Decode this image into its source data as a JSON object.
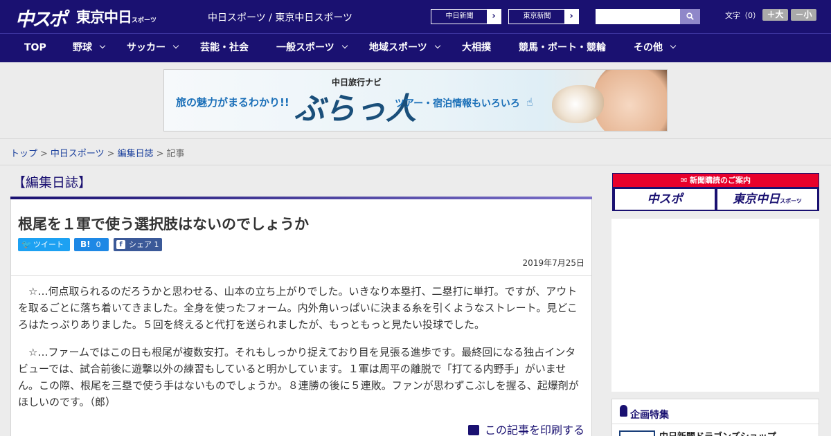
{
  "header": {
    "logo_main": "中スポ",
    "logo_sub": "東京中日",
    "logo_sub_small": "スポーツ",
    "site_links": "中日スポーツ / 東京中日スポーツ",
    "buttons": [
      {
        "label": "中日新聞"
      },
      {
        "label": "東京新聞"
      }
    ],
    "search_placeholder": "",
    "font_label": "文字（0）",
    "font_plus": "＋大",
    "font_minus": "－小"
  },
  "nav": {
    "items": [
      {
        "label": "TOP"
      },
      {
        "label": "野球"
      },
      {
        "label": "サッカー"
      },
      {
        "label": "芸能・社会"
      },
      {
        "label": "一般スポーツ"
      },
      {
        "label": "地域スポーツ"
      },
      {
        "label": "大相撲"
      },
      {
        "label": "競馬・ボート・競輪"
      },
      {
        "label": "その他"
      }
    ]
  },
  "banner": {
    "tagline_left": "旅の魅力がまるわかり!!",
    "navi": "中日旅行ナビ",
    "brand": "ぶらっ人",
    "tagline_right": "ツアー・宿泊情報もいろいろ",
    "hand": "☝"
  },
  "breadcrumb": {
    "items": [
      "トップ",
      "中日スポーツ",
      "編集日誌"
    ],
    "current": "記事",
    "separator": ">"
  },
  "section": {
    "title": "【編集日誌】"
  },
  "article": {
    "headline": "根尾を１軍で使う選択肢はないのでしょうか",
    "share": {
      "tweet": "ツイート",
      "hatena_icon": "B!",
      "hatena_count": "0",
      "fb_icon": "f",
      "fb_label": "シェア 1"
    },
    "date": "2019年7月25日",
    "paragraphs": [
      "　☆…何点取られるのだろうかと思わせる、山本の立ち上がりでした。いきなり本塁打、二塁打に単打。ですが、アウトを取るごとに落ち着いてきました。全身を使ったフォーム。内外角いっぱいに決まる糸を引くようなストレート。見どころはたっぷりありました。５回を終えると代打を送られましたが、もっともっと見たい投球でした。",
      "　☆…ファームではこの日も根尾が複数安打。それもしっかり捉えており目を見張る進歩です。最終回になる独占インタビューでは、試合前後に遊撃以外の練習もしていると明かしています。１軍は周平の離脱で「打てる内野手」がいません。この際、根尾を三塁で使う手はないものでしょうか。８連勝の後に５連敗。ファンが思わずこぶしを握る、起爆剤がほしいのです。（郎）"
    ],
    "print_label": "この記事を印刷する"
  },
  "sidebar": {
    "subscription_heading": "新聞購読のご案内",
    "subscription_left": "中スポ",
    "subscription_right": "東京中日",
    "subscription_right_small": "スポーツ",
    "feature_title": "企画特集",
    "feature_item": "中日新聞ドラゴンズショップ"
  },
  "colors": {
    "brand_navy": "#1a1171",
    "subscription_red": "#e8002b",
    "twitter": "#1da1f2",
    "hatena": "#1e88e5",
    "facebook": "#3b5998"
  }
}
